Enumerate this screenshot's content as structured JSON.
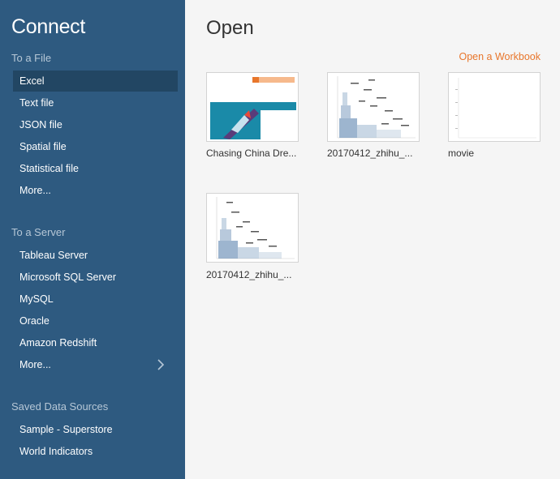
{
  "sidebar": {
    "title": "Connect",
    "file_section": {
      "label": "To a File",
      "items": [
        "Excel",
        "Text file",
        "JSON file",
        "Spatial file",
        "Statistical file",
        "More..."
      ]
    },
    "server_section": {
      "label": "To a Server",
      "items": [
        "Tableau Server",
        "Microsoft SQL Server",
        "MySQL",
        "Oracle",
        "Amazon Redshift",
        "More..."
      ]
    },
    "saved_section": {
      "label": "Saved Data Sources",
      "items": [
        "Sample - Superstore",
        "World Indicators"
      ]
    }
  },
  "main": {
    "title": "Open",
    "open_workbook_label": "Open a Workbook",
    "workbooks": [
      {
        "label": "Chasing China Dre..."
      },
      {
        "label": "20170412_zhihu_..."
      },
      {
        "label": "movie"
      },
      {
        "label": "20170412_zhihu_..."
      }
    ]
  },
  "colors": {
    "sidebar_bg": "#2e5a80",
    "sidebar_selected": "#224663",
    "accent_orange": "#e8762b"
  }
}
